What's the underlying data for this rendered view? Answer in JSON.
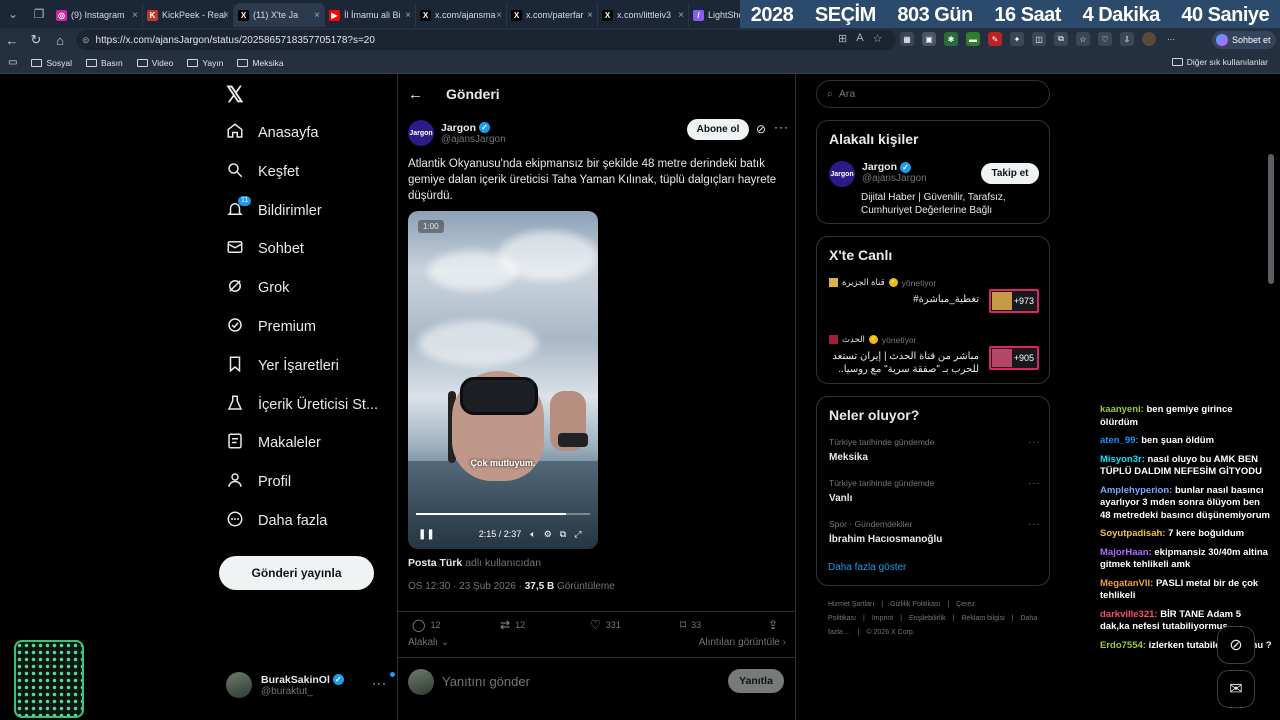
{
  "tabs": [
    {
      "title": "(9) Instagram",
      "color": "#d6249f",
      "icon": "instagram-icon",
      "letter": "◎"
    },
    {
      "title": "KickPeek - Real",
      "color": "#c0392b",
      "icon": "kickpeek-icon",
      "letter": "K"
    },
    {
      "title": "(11) X'te Ja",
      "color": "#000000",
      "icon": "x-icon",
      "letter": "X",
      "active": true
    },
    {
      "title": "İl İmamu ali Bi",
      "color": "#ff0000",
      "icon": "youtube-icon",
      "letter": "▶"
    },
    {
      "title": "x.com/ajansma",
      "color": "#000000",
      "icon": "x-icon",
      "letter": "X"
    },
    {
      "title": "x.com/paterfar",
      "color": "#000000",
      "icon": "x-icon",
      "letter": "X"
    },
    {
      "title": "x.com/littleiv3",
      "color": "#000000",
      "icon": "x-icon",
      "letter": "X"
    },
    {
      "title": "LightShot",
      "color": "#8a5cf6",
      "icon": "lightshot-icon",
      "letter": "/"
    }
  ],
  "countdown": {
    "year": "2028",
    "label": "SEÇİM",
    "days": "803 Gün",
    "hours": "16 Saat",
    "minutes": "4 Dakika",
    "seconds": "40 Saniye"
  },
  "browser": {
    "url": "https://x.com/ajansJargon/status/2025865718357705178?s=20",
    "chat_button": "Sohbet et",
    "bookmarks": [
      "Sosyal",
      "Basın",
      "Video",
      "Yayın",
      "Meksika"
    ],
    "bookmarks_right": "Diğer sık kullanılanlar"
  },
  "nav": {
    "items": [
      {
        "label": "Anasayfa",
        "icon": "home-icon"
      },
      {
        "label": "Keşfet",
        "icon": "search-icon"
      },
      {
        "label": "Bildirimler",
        "icon": "bell-icon"
      },
      {
        "label": "Sohbet",
        "icon": "mail-icon"
      },
      {
        "label": "Grok",
        "icon": "grok-icon"
      },
      {
        "label": "Premium",
        "icon": "premium-icon"
      },
      {
        "label": "Yer İşaretleri",
        "icon": "bookmark-icon"
      },
      {
        "label": "İçerik Üreticisi St...",
        "icon": "flask-icon"
      },
      {
        "label": "Makaleler",
        "icon": "article-icon"
      },
      {
        "label": "Profil",
        "icon": "person-icon"
      },
      {
        "label": "Daha fazla",
        "icon": "more-circle-icon"
      }
    ],
    "notification_count": "11",
    "post_button": "Gönderi yayınla",
    "user": {
      "name": "BurakSakinOl",
      "handle": "@buraktut_"
    }
  },
  "post": {
    "page_title": "Gönderi",
    "author_name": "Jargon",
    "author_handle": "@ajansJargon",
    "avatar_text": "Jargon",
    "subscribe": "Abone ol",
    "text": "Atlantik Okyanusu'nda ekipmansız bir şekilde 48 metre derindeki batık gemiye dalan içerik üreticisi Taha Yaman Kılınak, tüplü dalgıçları hayrete düşürdü.",
    "video": {
      "time_tag": "1:00",
      "subtitle": "Çok mutluyum.",
      "time": "2:15 / 2:37",
      "progress": 0.86
    },
    "attribution_user": "Posta Türk",
    "attribution_suffix": "adlı kullanıcıdan",
    "timestamp": "ÖS 12:30 · 23 Şub 2026 · ",
    "views": "37,5 B",
    "views_label": "Görüntüleme",
    "replies": "12",
    "reposts": "12",
    "likes": "331",
    "bookmarks": "33",
    "sort": "Alakalı",
    "quotes": "Alıntıları görüntüle",
    "reply_placeholder": "Yanıtını gönder",
    "reply_button": "Yanıtla"
  },
  "sidebar": {
    "search_placeholder": "Ara",
    "relevant_title": "Alakalı kişiler",
    "relevant_name": "Jargon",
    "relevant_handle": "@ajansJargon",
    "follow": "Takip et",
    "relevant_bio": "Dijital Haber | Güvenilir, Tarafsız, Cumhuriyet Değerlerine Bağlı",
    "live_title": "X'te Canlı",
    "live": [
      {
        "source": "قناة الجزيرة",
        "role": "yönetiyor",
        "title": "تغطية_مباشرة#",
        "count": "+973"
      },
      {
        "source": "الحدث",
        "role": "yönetiyor",
        "title": "مباشر من قناة الحدث | إيران تستعد للحرب بـ \"صفقة سرية\" مع روسيا..",
        "count": "+905"
      }
    ],
    "trends_title": "Neler oluyor?",
    "trends": [
      {
        "category": "Türkiye tarihinde gündemde",
        "name": "Meksika"
      },
      {
        "category": "Türkiye tarihinde gündemde",
        "name": "Vanlı"
      },
      {
        "category": "Spor · Gündemdekiler",
        "name": "İbrahim Hacıosmanoğlu"
      }
    ],
    "show_more": "Daha fazla göster",
    "footer": [
      "Hizmet Şartları",
      "Gizlilik Politikası",
      "Çerez Politikası",
      "Imprint",
      "Erişilebilirlik",
      "Reklam bilgisi",
      "Daha fazla ...",
      "© 2026 X Corp."
    ]
  },
  "chat": [
    {
      "user": "kaanyeni",
      "color": "#9acd32",
      "msg": "ben gemiye girince ölürdüm"
    },
    {
      "user": "aten_99",
      "color": "#1e90ff",
      "msg": "ben şuan öldüm"
    },
    {
      "user": "Misyon3r",
      "color": "#00e5ff",
      "msg": "nasıl oluyo bu AMK BEN TÜPLÜ DALDIM NEFESİM GİTYODU"
    },
    {
      "user": "Amplehyperion",
      "color": "#7aa7ff",
      "msg": "bunlar nasıl basıncı ayarlıyor 3 mden sonra ölüyom ben 48 metredeki basıncı düşünemiyorum"
    },
    {
      "user": "Soyutpadisah",
      "color": "#f0c040",
      "msg": "7 kere boğuldum"
    },
    {
      "user": "MajorHaan",
      "color": "#b06cff",
      "msg": "ekipmansiz 30/40m altina gitmek tehlikeli amk"
    },
    {
      "user": "MegatanVII",
      "color": "#f0a030",
      "msg": "PASLI metal bir de çok tehlikeli"
    },
    {
      "user": "darkville321",
      "color": "#ff4d6a",
      "msg": "BİR TANE Adam 5 dak,ka nefesi tutabiliyormuş"
    },
    {
      "user": "Erdo7554",
      "color": "#9acd32",
      "msg": "izlerken tutabilen oldumu ?"
    }
  ]
}
